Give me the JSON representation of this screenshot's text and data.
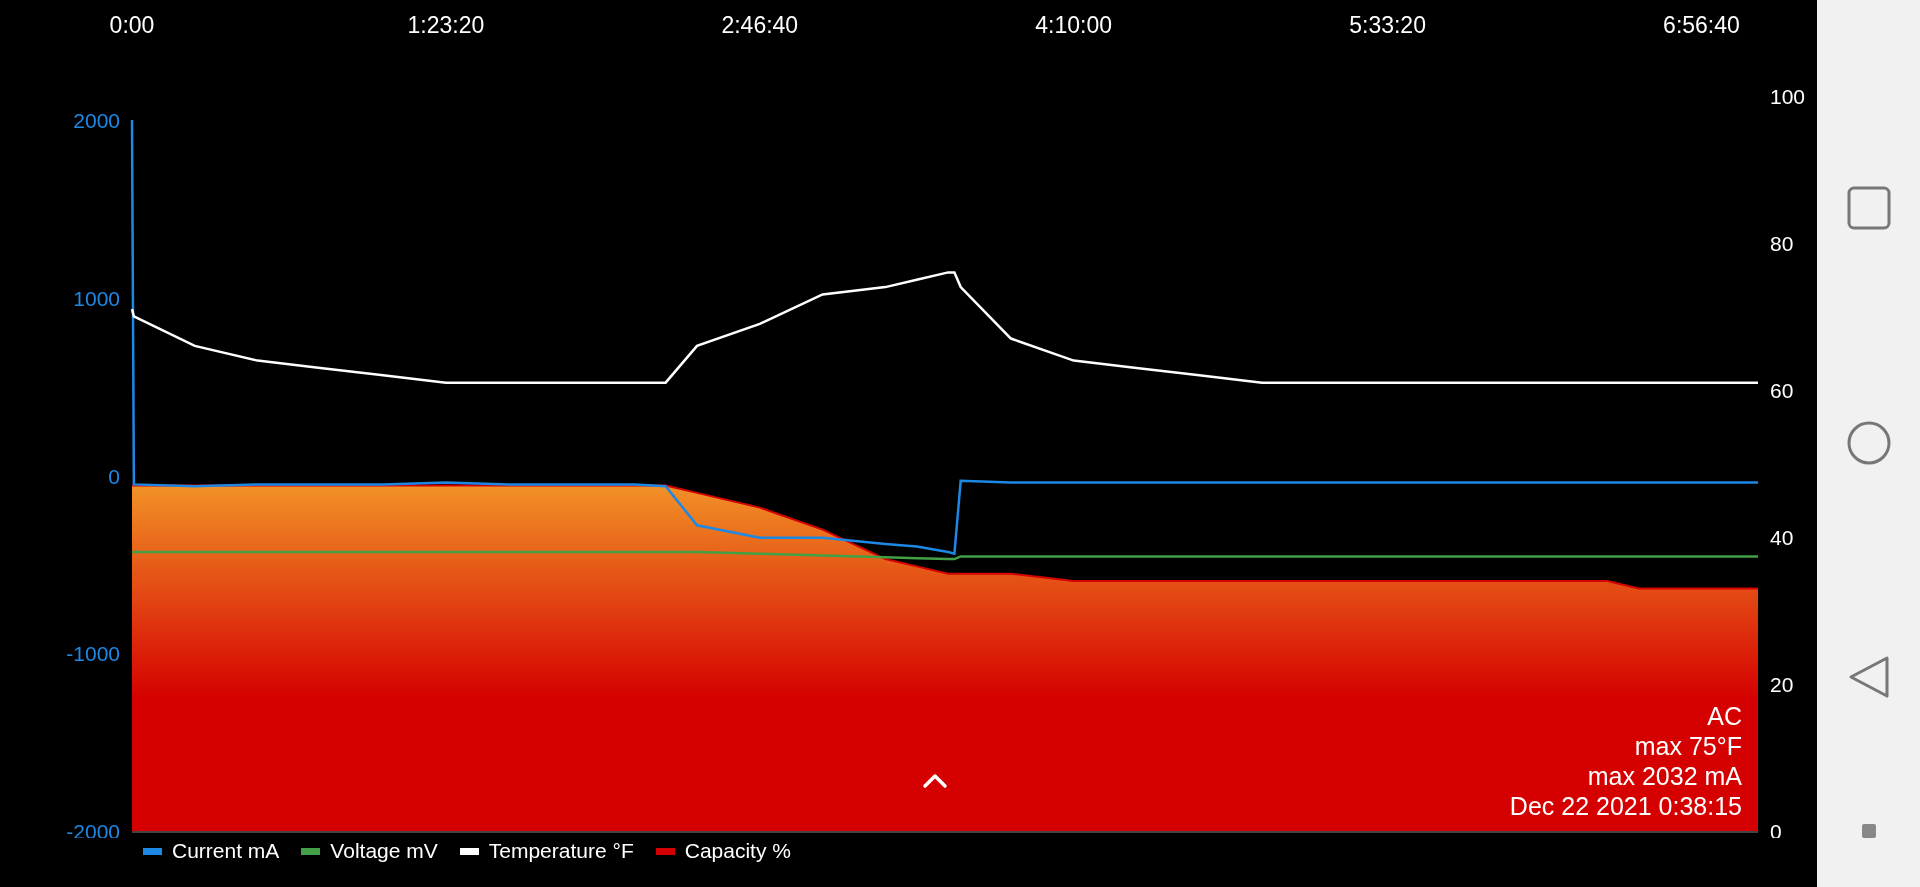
{
  "chart": {
    "chart_data": {
      "type": "line",
      "x": [
        0,
        30,
        1000,
        2000,
        3000,
        4000,
        5000,
        6000,
        7000,
        8000,
        8500,
        9000,
        10000,
        11000,
        12000,
        12500,
        13000,
        13100,
        13200,
        14000,
        15000,
        16000,
        17000,
        18000,
        19000,
        20000,
        21000,
        22000,
        23000,
        23500,
        24000,
        25000,
        25900
      ],
      "xlim": [
        0,
        25900
      ],
      "legend": "bottom",
      "xticks": [
        {
          "value": 0,
          "label": "0:00"
        },
        {
          "value": 5000,
          "label": "1:23:20"
        },
        {
          "value": 10000,
          "label": "2:46:40"
        },
        {
          "value": 15000,
          "label": "4:10:00"
        },
        {
          "value": 20000,
          "label": "5:33:20"
        },
        {
          "value": 25000,
          "label": "6:56:40"
        }
      ],
      "ylim": [
        -2000,
        2000
      ],
      "yticks": [
        -2000,
        -1000,
        0,
        1000,
        2000
      ],
      "y2lim": [
        0,
        100
      ],
      "y2ticks": [
        0,
        20,
        40,
        60,
        80,
        100
      ],
      "series": [
        {
          "name": "Current mA",
          "color": "#1e88e5",
          "values": [
            2000,
            -50,
            -60,
            -50,
            -50,
            -50,
            -40,
            -50,
            -50,
            -50,
            -60,
            -280,
            -350,
            -350,
            -385,
            -400,
            -430,
            -440,
            -30,
            -40,
            -40,
            -40,
            -40,
            -40,
            -40,
            -40,
            -40,
            -40,
            -40,
            -40,
            -40,
            -40,
            -40
          ]
        },
        {
          "name": "Voltage mV",
          "color": "#43a047",
          "values": [
            -430,
            -430,
            -430,
            -430,
            -430,
            -430,
            -430,
            -430,
            -430,
            -430,
            -430,
            -430,
            -440,
            -450,
            -460,
            -465,
            -470,
            -470,
            -455,
            -455,
            -455,
            -455,
            -455,
            -455,
            -455,
            -455,
            -455,
            -455,
            -455,
            -455,
            -455,
            -455,
            -455
          ]
        },
        {
          "name": "Temperature °F",
          "color": "#ffffff",
          "axis": "y2",
          "values": [
            71,
            70,
            66,
            64,
            63,
            62,
            61,
            61,
            61,
            61,
            61,
            66,
            69,
            73,
            74,
            75,
            76,
            76,
            74,
            67,
            64,
            63,
            62,
            61,
            61,
            61,
            61,
            61,
            61,
            61,
            61,
            61,
            61
          ]
        },
        {
          "name": "Capacity %",
          "color": "#d50000",
          "type": "area",
          "axis": "y2",
          "values": [
            47,
            47,
            47,
            47,
            47,
            47,
            47,
            47,
            47,
            47,
            47,
            46,
            44,
            41,
            37,
            36,
            35,
            35,
            35,
            35,
            34,
            34,
            34,
            34,
            34,
            34,
            34,
            34,
            34,
            34,
            33,
            33,
            33
          ]
        }
      ]
    },
    "info_lines": [
      "AC",
      "max 75°F",
      "max 2032 mA",
      "Dec 22 2021 0:38:15"
    ]
  }
}
